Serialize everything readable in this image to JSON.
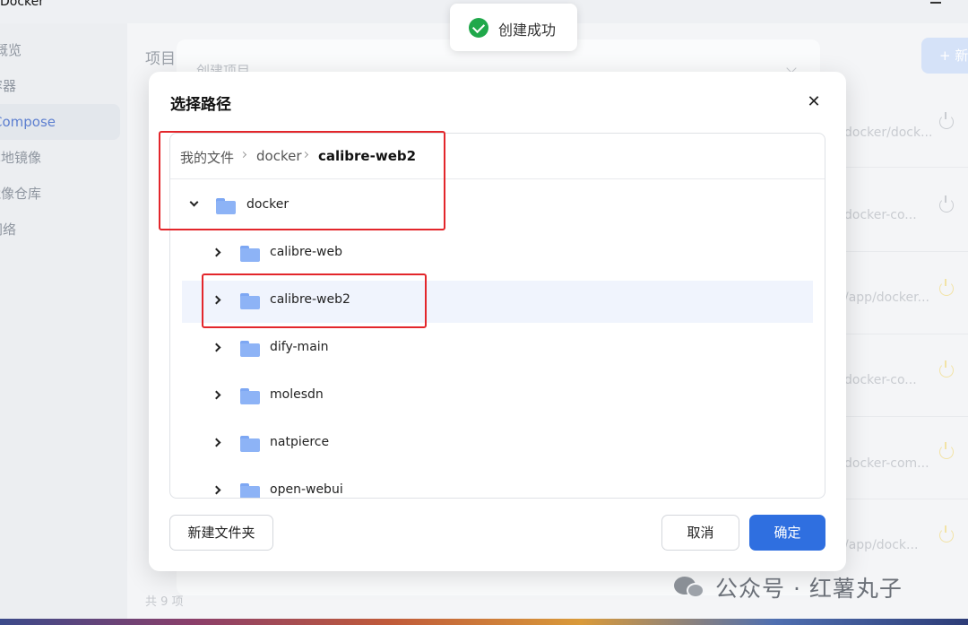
{
  "app": {
    "title": "Docker",
    "sidebar": [
      {
        "label": "概览"
      },
      {
        "label": "容器"
      },
      {
        "label": "Compose"
      },
      {
        "label": "本地镜像"
      },
      {
        "label": "镜像仓库"
      },
      {
        "label": "网络"
      }
    ],
    "page_title": "项目",
    "card_title": "创建项目",
    "new_button": "+ 新建",
    "rows": [
      {
        "path": "docker/dock..."
      },
      {
        "path": "docker-co..."
      },
      {
        "path": "/app/docker..."
      },
      {
        "path": "docker-co..."
      },
      {
        "path": "docker-com..."
      },
      {
        "path": "/app/dock..."
      }
    ],
    "total": "共 9 项"
  },
  "toast": {
    "text": "创建成功",
    "icon_color": "#1fa84a"
  },
  "dialog": {
    "title": "选择路径",
    "breadcrumb": [
      "我的文件",
      "docker",
      "calibre-web2"
    ],
    "root": "docker",
    "children": [
      "calibre-web",
      "calibre-web2",
      "dify-main",
      "molesdn",
      "natpierce",
      "open-webui"
    ],
    "selected": "calibre-web2",
    "new_folder_button": "新建文件夹",
    "cancel_button": "取消",
    "ok_button": "确定"
  },
  "watermark": "公众号 · 红薯丸子",
  "colors": {
    "accent": "#2f6fe0",
    "highlight": "#e3262b",
    "folder": "#8db3f6",
    "selected_row": "#f0f4fd"
  }
}
